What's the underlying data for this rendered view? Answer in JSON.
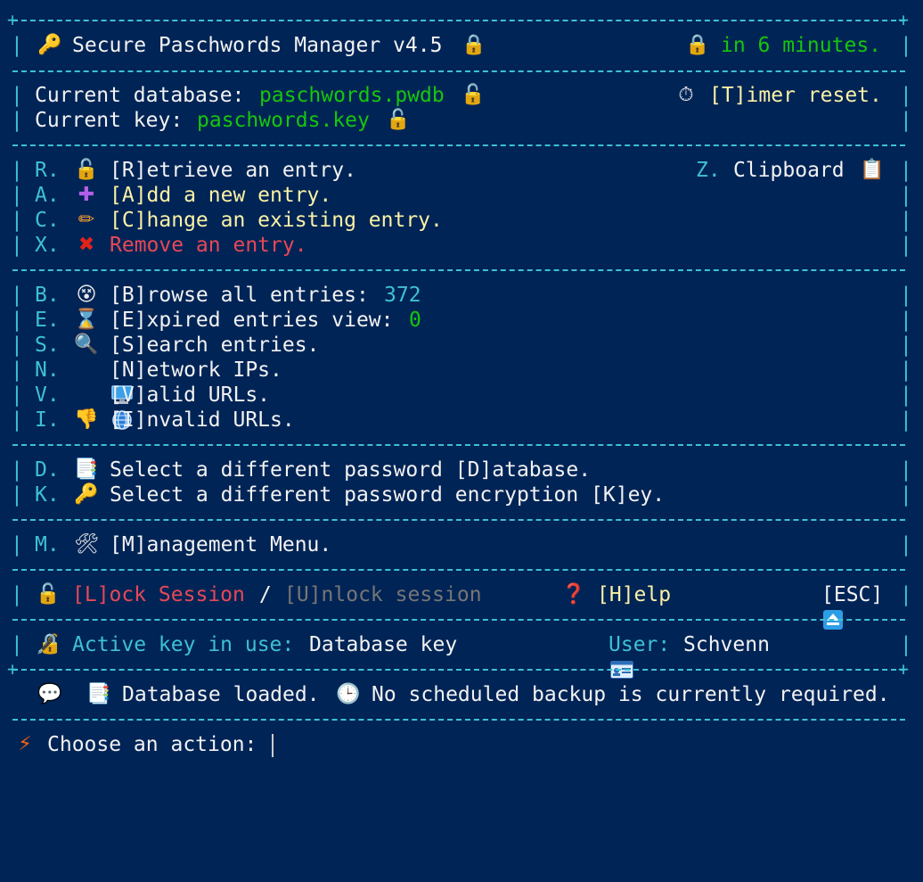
{
  "header": {
    "icon": "key-icon",
    "title": "Secure Paschwords Manager v4.5",
    "title_lock": "lock-icon",
    "timer_lock": "lock-icon",
    "timer_text": "in 6 minutes."
  },
  "db": {
    "db_label": "Current database: ",
    "db_name": "paschwords.pwdb",
    "key_label": "Current key: ",
    "key_name": "paschwords.key",
    "timer_reset": "[T]imer reset."
  },
  "menu1": [
    {
      "letter": "R.",
      "icon": "unlock-icon",
      "label": "[R]etrieve an entry.",
      "color": "#f2f2f2"
    },
    {
      "letter": "A.",
      "icon": "plus-icon",
      "label": "[A]dd a new entry.",
      "color": "#f9f1a5"
    },
    {
      "letter": "C.",
      "icon": "pencil-icon",
      "label": "[C]hange an existing entry.",
      "color": "#f9f1a5"
    },
    {
      "letter": "X.",
      "icon": "cross-icon",
      "label": "Remove an entry.",
      "color": "#e74856"
    }
  ],
  "clipboard": {
    "letter": "Z.",
    "label": "Clipboard",
    "icon": "clipboard-icon"
  },
  "menu2": [
    {
      "letter": "B.",
      "icon": "eyes-icon",
      "label": "[B]rowse all entries: ",
      "count": "372"
    },
    {
      "letter": "E.",
      "icon": "hourglass-icon",
      "label": "[E]xpired entries view: ",
      "count": "0"
    },
    {
      "letter": "S.",
      "icon": "magnifier-icon",
      "label": "[S]earch entries.",
      "count": ""
    },
    {
      "letter": "N.",
      "icon": "computer-icon",
      "label": "[N]etwork IPs.",
      "count": ""
    },
    {
      "letter": "V.",
      "icon": "globe-icon",
      "label": "[V]alid URLs.",
      "count": ""
    },
    {
      "letter": "I.",
      "icon": "thumbs-down-icon",
      "label": "[I]nvalid URLs.",
      "count": ""
    }
  ],
  "menu3": [
    {
      "letter": "D.",
      "icon": "document-icon",
      "label": "Select a different password [D]atabase."
    },
    {
      "letter": "K.",
      "icon": "key-icon",
      "label": "Select a different password encryption [K]ey."
    }
  ],
  "menu4": {
    "letter": "M.",
    "icon": "tools-icon",
    "label": "[M]anagement Menu."
  },
  "session": {
    "lock_label": "[L]ock Session",
    "sep": " / ",
    "unlock_label": "[U]nlock session",
    "help_label": "[H]elp",
    "esc_label": "[ESC]"
  },
  "status": {
    "active_label": "Active key in use: ",
    "active_value": "Database key",
    "user_label": "User: ",
    "user_value": "Schvenn"
  },
  "message": {
    "db_loaded": "Database loaded.",
    "backup": "No scheduled backup is currently required."
  },
  "prompt": {
    "label": "Choose an action: "
  }
}
